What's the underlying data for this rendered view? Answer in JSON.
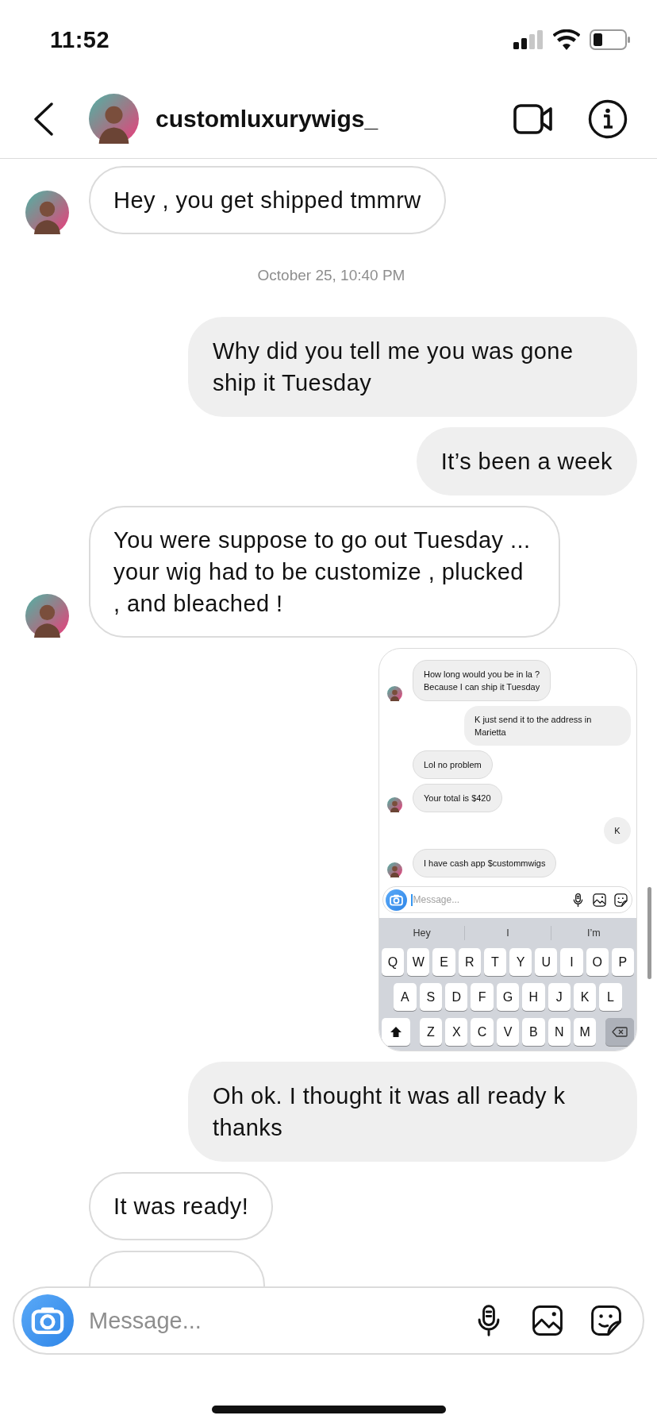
{
  "status_bar": {
    "time": "11:52"
  },
  "header": {
    "username": "customluxurywigs_"
  },
  "messages": [
    {
      "kind": "message",
      "outgoing": false,
      "text": "Hey , you get shipped tmmrw",
      "avatar": true
    },
    {
      "kind": "timestamp",
      "text": "October 25, 10:40 PM"
    },
    {
      "kind": "message",
      "outgoing": true,
      "text": "Why did you tell me you was gone ship it Tuesday"
    },
    {
      "kind": "message",
      "outgoing": true,
      "text": "It’s been a week"
    },
    {
      "kind": "message",
      "outgoing": false,
      "text": "You were suppose to go out Tuesday ... your wig had to be customize , plucked , and bleached !",
      "avatar": true
    },
    {
      "kind": "screenshot",
      "outgoing": true,
      "messages": [
        {
          "outgoing": false,
          "text": "How long would you be in la ?\nBecause I can ship it Tuesday",
          "avatar": true
        },
        {
          "outgoing": true,
          "text": "K just send it to the address in Marietta"
        },
        {
          "outgoing": false,
          "text": "Lol no problem",
          "avatar": false
        },
        {
          "outgoing": false,
          "text": "Your total is $420",
          "avatar": true
        },
        {
          "outgoing": true,
          "text": "K"
        },
        {
          "outgoing": false,
          "text": "I have cash app $custommwigs",
          "avatar": true
        }
      ],
      "composer": {
        "placeholder": "Message..."
      },
      "keyboard": {
        "suggestions": [
          "Hey",
          "I",
          "I’m"
        ],
        "rows": [
          [
            "Q",
            "W",
            "E",
            "R",
            "T",
            "Y",
            "U",
            "I",
            "O",
            "P"
          ],
          [
            "A",
            "S",
            "D",
            "F",
            "G",
            "H",
            "J",
            "K",
            "L"
          ],
          [
            "Z",
            "X",
            "C",
            "V",
            "B",
            "N",
            "M"
          ]
        ]
      }
    },
    {
      "kind": "message",
      "outgoing": true,
      "text": "Oh ok. I thought it was all ready k thanks"
    },
    {
      "kind": "message",
      "outgoing": false,
      "text": "It was ready!",
      "avatar": false
    },
    {
      "kind": "message",
      "outgoing": false
    }
  ],
  "composer": {
    "placeholder": "Message..."
  }
}
